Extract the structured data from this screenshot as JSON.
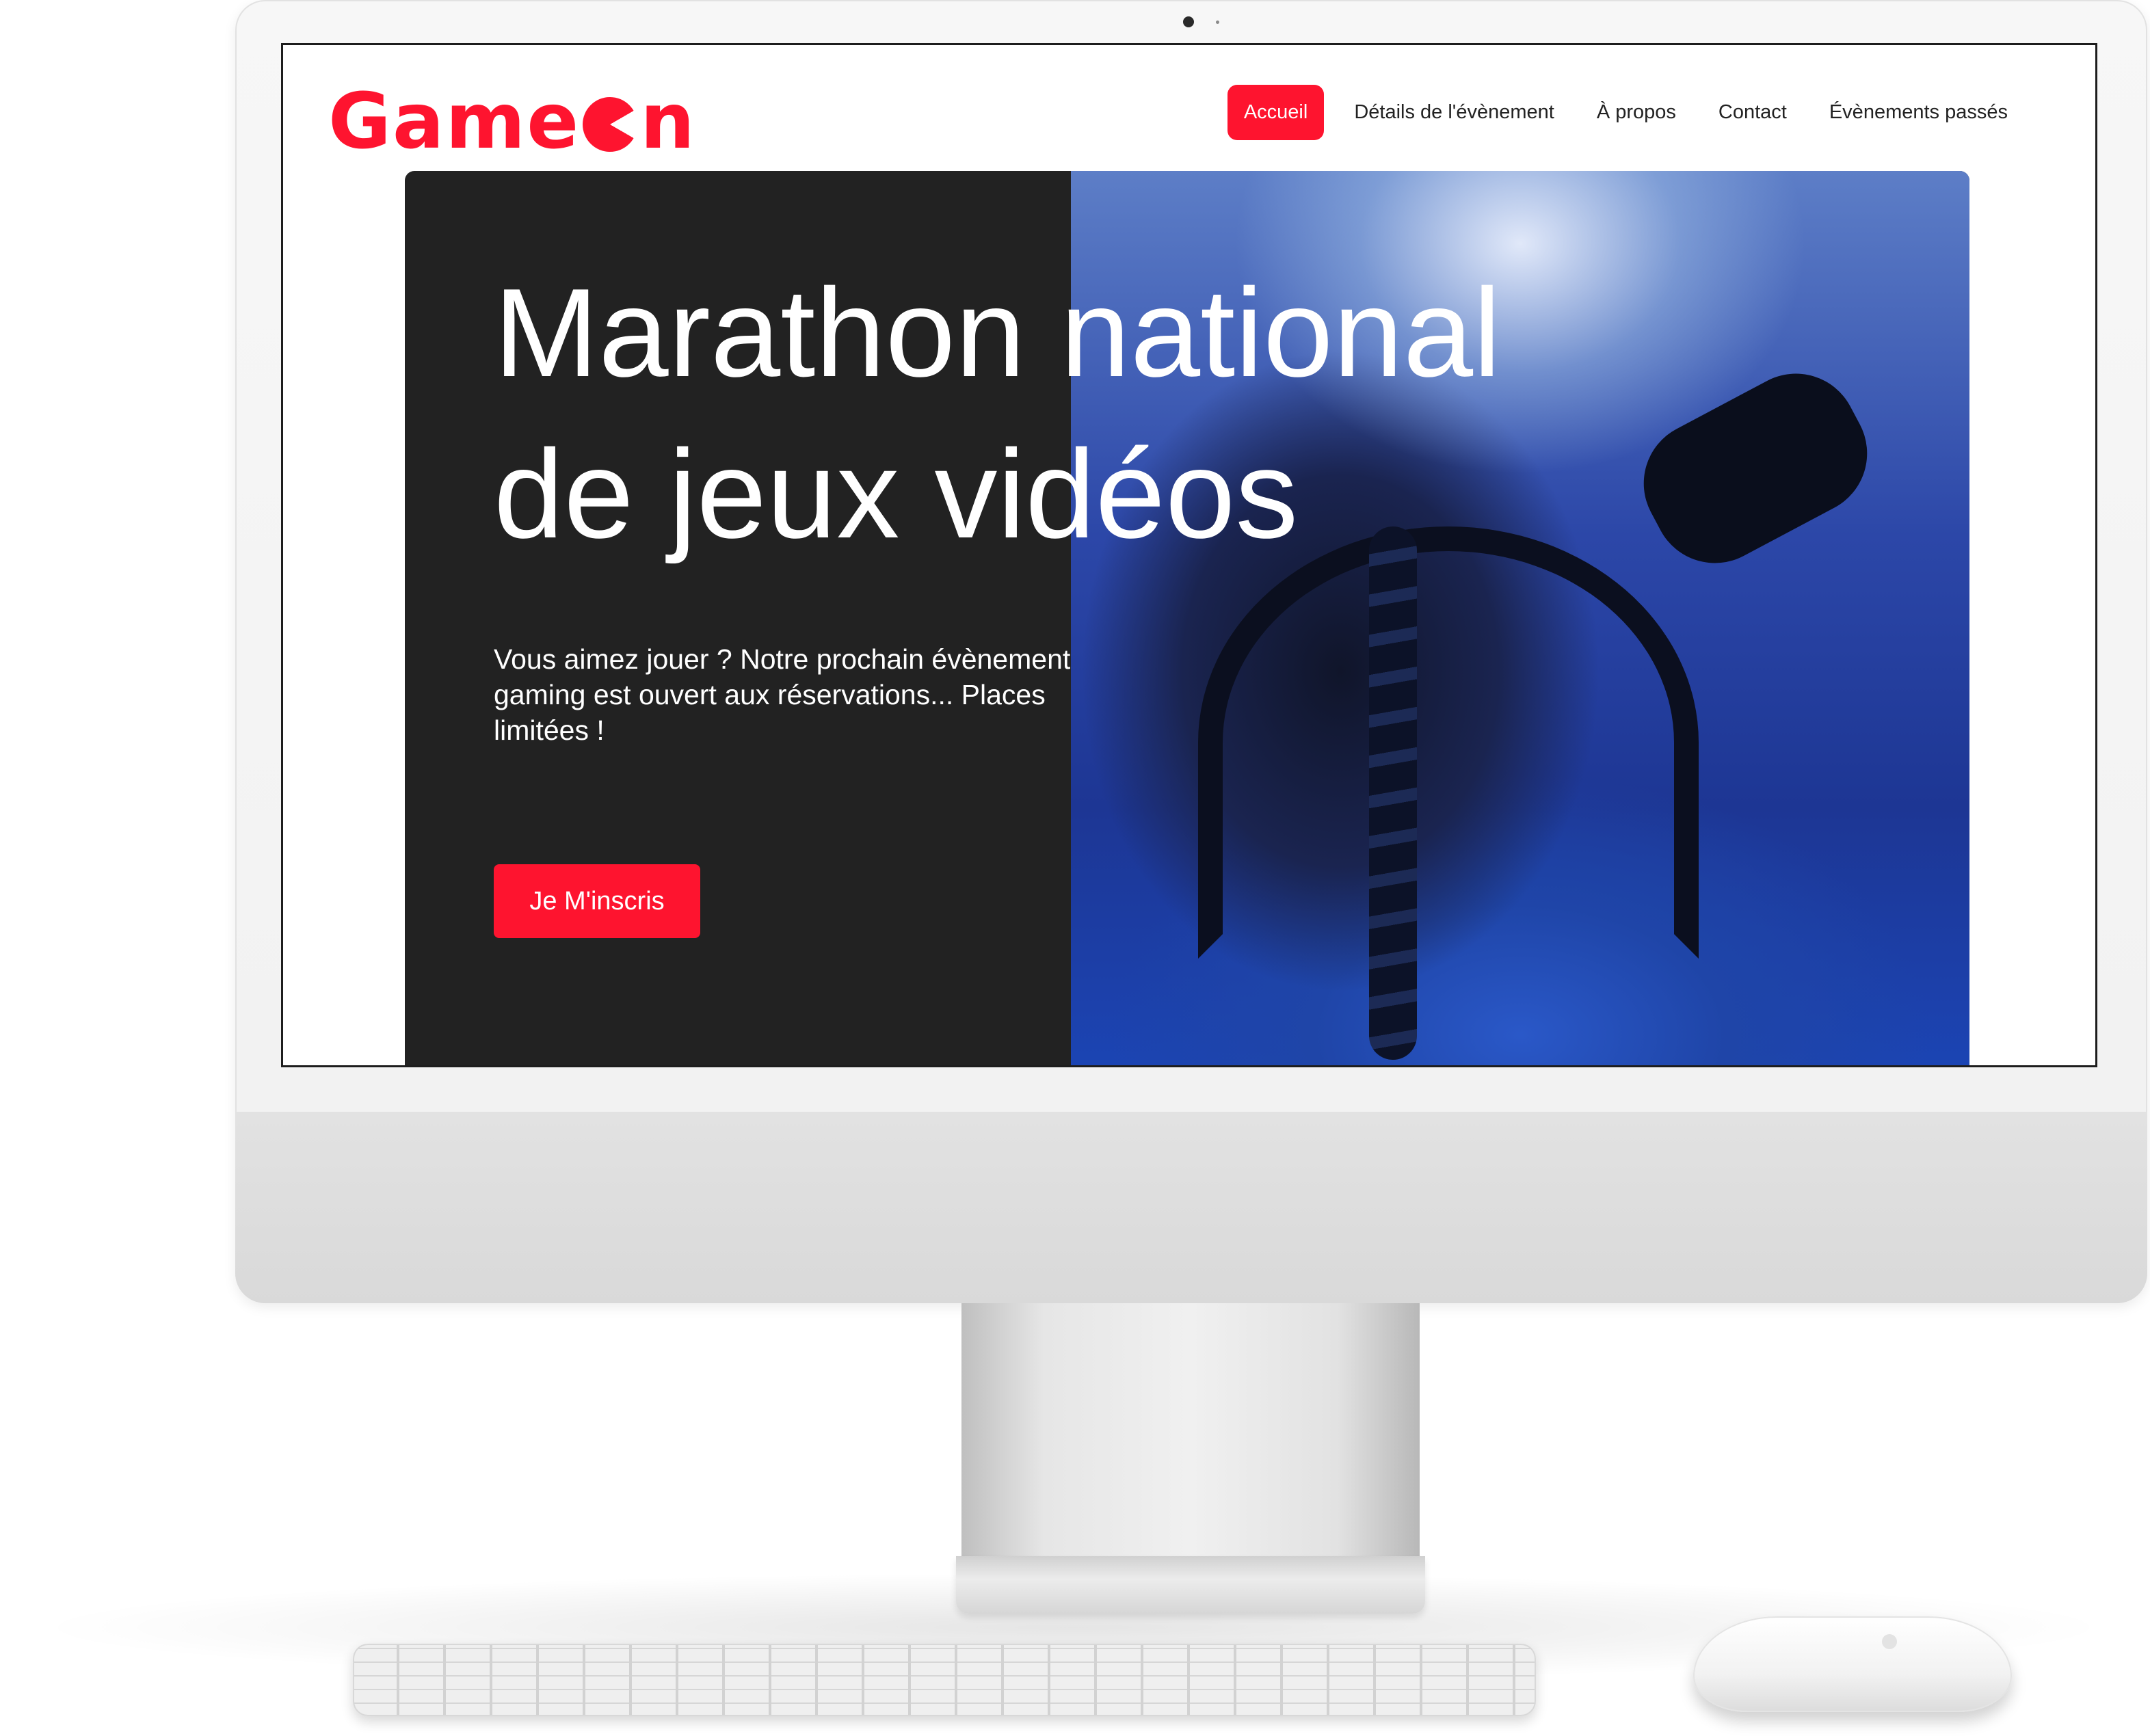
{
  "brand": {
    "logo_left": "Game",
    "logo_right": "n"
  },
  "nav": {
    "items": [
      {
        "label": "Accueil",
        "active": true
      },
      {
        "label": "Détails de l'évènement",
        "active": false
      },
      {
        "label": "À propos",
        "active": false
      },
      {
        "label": "Contact",
        "active": false
      },
      {
        "label": "Évènements passés",
        "active": false
      }
    ]
  },
  "hero": {
    "title": "Marathon national de jeux vidéos",
    "text": "Vous aimez jouer ? Notre prochain évènement\ngaming est ouvert aux réservations... Places limitées !",
    "cta_label": "Je M'inscris"
  },
  "colors": {
    "accent": "#fe142f",
    "hero_dark": "#222222",
    "text_light": "#ffffff"
  },
  "icons": [
    "camera-icon",
    "apple-logo-icon"
  ]
}
